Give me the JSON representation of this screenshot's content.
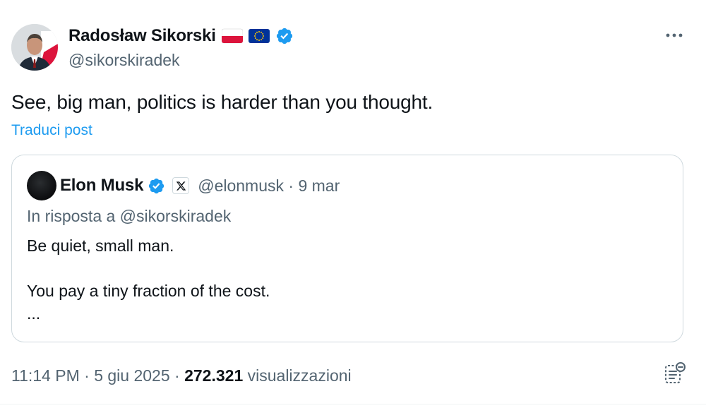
{
  "post": {
    "author_name": "Radosław Sikorski",
    "author_handle": "@sikorskiradek",
    "text": "See, big man, politics is harder than you thought.",
    "translate_label": "Traduci post",
    "timestamp": "11:14 PM",
    "date": "5 giu 2025",
    "separator": "·",
    "views_count": "272.321",
    "views_label": "visualizzazioni",
    "icons": {
      "flags": [
        "poland-flag-icon",
        "eu-flag-icon"
      ],
      "verified": "verified-badge-icon",
      "more": "more-options-icon",
      "analytics": "post-analytics-icon"
    }
  },
  "quoted_post": {
    "author_name": "Elon Musk",
    "author_handle": "@elonmusk",
    "separator": "·",
    "date": "9 mar",
    "reply_to": "In risposta a @sikorskiradek",
    "lines": [
      "Be quiet, small man.",
      "You pay a tiny fraction of the cost.",
      "..."
    ],
    "icons": {
      "verified": "verified-badge-icon",
      "affiliate": "x-logo-icon"
    }
  },
  "colors": {
    "text": "#0f1419",
    "secondary": "#536471",
    "link": "#1d9bf0",
    "verified": "#1d9bf0",
    "border": "#cfd9de"
  }
}
